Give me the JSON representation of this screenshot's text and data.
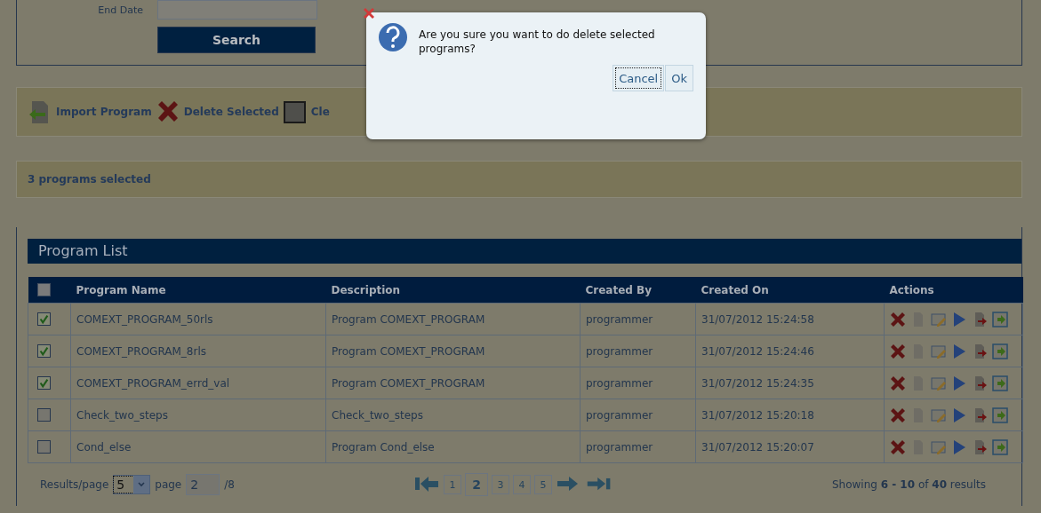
{
  "search": {
    "label": "End Date",
    "button": "Search"
  },
  "toolbar": [
    {
      "kind": "import",
      "label": "Import Program"
    },
    {
      "kind": "delete",
      "label": "Delete Selected"
    },
    {
      "kind": "clear",
      "label": "Cle"
    }
  ],
  "selection_status": "3 programs selected",
  "program_list": {
    "title": "Program List",
    "select_all": {
      "checked": false
    },
    "columns": [
      "Program Name",
      "Description",
      "Created By",
      "Created On",
      "Actions"
    ],
    "rows": [
      {
        "checked": true,
        "name": "COMEXT_PROGRAM_50rls",
        "description": "Program COMEXT_PROGRAM",
        "created_by": "programmer",
        "created_on": "31/07/2012 15:24:58"
      },
      {
        "checked": true,
        "name": "COMEXT_PROGRAM_8rls",
        "description": "Program COMEXT_PROGRAM",
        "created_by": "programmer",
        "created_on": "31/07/2012 15:24:46"
      },
      {
        "checked": true,
        "name": "COMEXT_PROGRAM_errd_val",
        "description": "Program COMEXT_PROGRAM",
        "created_by": "programmer",
        "created_on": "31/07/2012 15:24:35"
      },
      {
        "checked": false,
        "name": "Check_two_steps",
        "description": "Check_two_steps",
        "created_by": "programmer",
        "created_on": "31/07/2012 15:20:18"
      },
      {
        "checked": false,
        "name": "Cond_else",
        "description": "Program Cond_else",
        "created_by": "programmer",
        "created_on": "31/07/2012 15:20:07"
      }
    ]
  },
  "pager": {
    "results_label": "Results/page",
    "per_page": "5",
    "page_label": "page",
    "page_value": "2",
    "page_total": "/8",
    "pages": [
      {
        "label": "1",
        "selected": false
      },
      {
        "label": "2",
        "selected": true
      },
      {
        "label": "3",
        "selected": false
      },
      {
        "label": "4",
        "selected": false
      },
      {
        "label": "5",
        "selected": false
      }
    ],
    "showing": "Showing **6 - 10** of **40** results"
  },
  "dialog": {
    "message": "Are you sure you want to do delete selected programs?",
    "buttons": [
      {
        "label": "Cancel",
        "focused": true
      },
      {
        "label": "Ok",
        "focused": false
      }
    ]
  }
}
